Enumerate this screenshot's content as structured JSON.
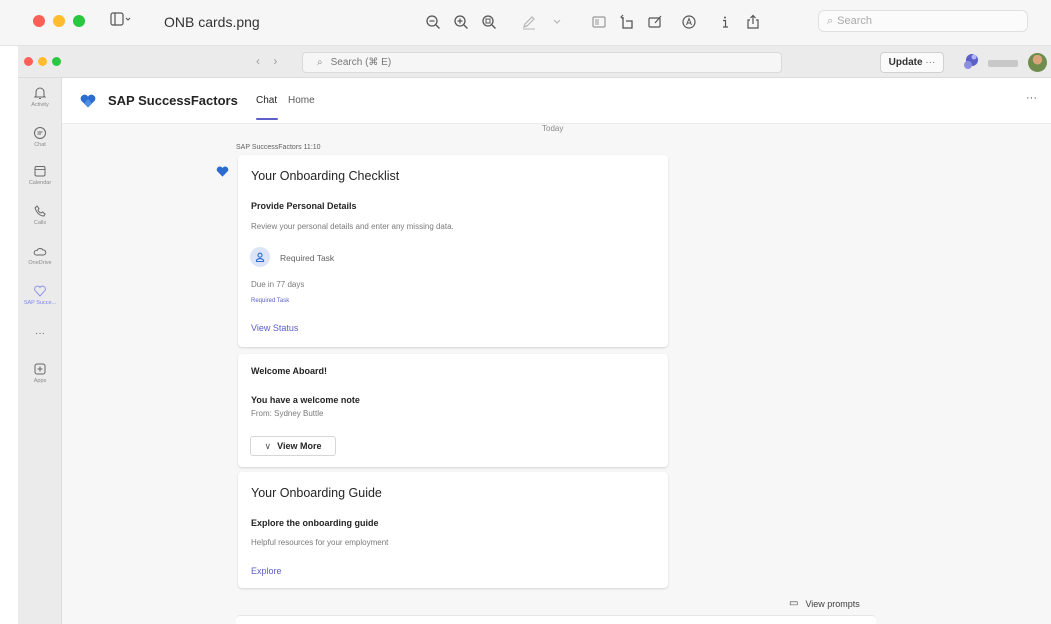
{
  "preview_window": {
    "file_title": "ONB cards.png",
    "search_placeholder": "Search",
    "toolbar_icons": [
      "zoom-out-icon",
      "zoom-in-icon",
      "zoom-to-fit-icon",
      "markup-pen-icon",
      "chevron-down-icon",
      "thumbnail-icon",
      "rotate-icon",
      "markup-icon",
      "highlight-icon",
      "info-icon",
      "share-icon"
    ]
  },
  "teams_bar": {
    "search_placeholder": "Search (⌘ E)",
    "update_label": "Update",
    "update_more": "···"
  },
  "rail": {
    "items": [
      {
        "label": "Activity",
        "icon": "bell-icon"
      },
      {
        "label": "Chat",
        "icon": "chat-icon"
      },
      {
        "label": "Calendar",
        "icon": "calendar-icon"
      },
      {
        "label": "Calls",
        "icon": "phone-icon"
      },
      {
        "label": "OneDrive",
        "icon": "cloud-icon"
      },
      {
        "label": "SAP Succe...",
        "icon": "sap-heart-icon"
      },
      {
        "label": "···",
        "icon": "more-icon"
      },
      {
        "label": "Apps",
        "icon": "add-app-icon"
      }
    ]
  },
  "app_header": {
    "app_name": "SAP SuccessFactors",
    "tabs": [
      "Chat",
      "Home"
    ],
    "more": "···"
  },
  "chat": {
    "date_divider": "Today",
    "sender_meta": "SAP SuccessFactors 11:10",
    "cards": {
      "checklist": {
        "title": "Your Onboarding Checklist",
        "subtitle": "Provide Personal Details",
        "description": "Review your personal details and enter any missing data.",
        "task_label": "Required Task",
        "due": "Due in 77 days",
        "task_link": "Required Task",
        "action": "View Status"
      },
      "welcome": {
        "title": "Welcome Aboard!",
        "subtitle": "You have a welcome note",
        "from": "From: Sydney Buttle",
        "action": "View More"
      },
      "guide": {
        "title": "Your Onboarding Guide",
        "subtitle": "Explore the onboarding guide",
        "description": "Helpful resources for your employment",
        "action": "Explore"
      }
    },
    "view_prompts": "View prompts"
  },
  "colors": {
    "accent": "#5b5fc7",
    "sap_blue": "#2d6ccf"
  }
}
